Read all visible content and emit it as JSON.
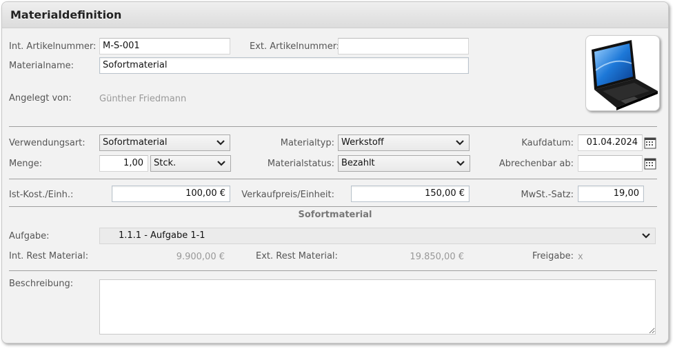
{
  "header": {
    "title": "Materialdefinition"
  },
  "fields": {
    "int_artikelnummer": {
      "label": "Int. Artikelnummer:",
      "value": "M-S-001"
    },
    "ext_artikelnummer": {
      "label": "Ext. Artikelnummer:",
      "value": ""
    },
    "materialname": {
      "label": "Materialname:",
      "value": "Sofortmaterial"
    },
    "angelegt_von": {
      "label": "Angelegt von:",
      "value": "Günther Friedmann"
    },
    "verwendungsart": {
      "label": "Verwendungsart:",
      "value": "Sofortmaterial"
    },
    "materialtyp": {
      "label": "Materialtyp:",
      "value": "Werkstoff"
    },
    "kaufdatum": {
      "label": "Kaufdatum:",
      "value": "01.04.2024"
    },
    "menge": {
      "label": "Menge:",
      "value": "1,00",
      "unit": "Stck."
    },
    "materialstatus": {
      "label": "Materialstatus:",
      "value": "Bezahlt"
    },
    "abrechenbar_ab": {
      "label": "Abrechenbar ab:",
      "value": ""
    },
    "ist_kost": {
      "label": "Ist-Kost./Einh.:",
      "value": "100,00 €"
    },
    "verkaufpreis": {
      "label": "Verkaufpreis/Einheit:",
      "value": "150,00 €"
    },
    "mwst": {
      "label": "MwSt.-Satz:",
      "value": "19,00"
    }
  },
  "section": {
    "title": "Sofortmaterial",
    "aufgabe": {
      "label": "Aufgabe:",
      "value": "1.1.1 - Aufgabe 1-1"
    },
    "int_rest": {
      "label": "Int. Rest Material:",
      "value": "9.900,00 €"
    },
    "ext_rest": {
      "label": "Ext. Rest Material:",
      "value": "19.850,00 €"
    },
    "freigabe": {
      "label": "Freigabe:",
      "value": "x"
    }
  },
  "beschreibung": {
    "label": "Beschreibung:",
    "value": ""
  },
  "icons": {
    "image": "laptop-image",
    "calendar": "calendar-icon",
    "dropdown": "chevron-down-icon"
  }
}
